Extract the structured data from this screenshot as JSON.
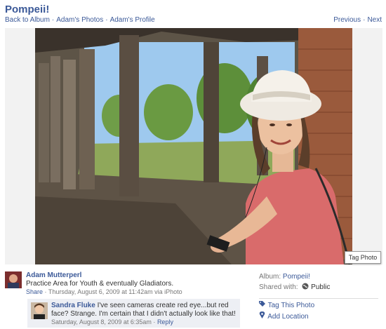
{
  "page": {
    "title": "Pompeii!"
  },
  "nav": {
    "back_to_album": "Back to Album",
    "sep1": "·",
    "adams_photos": "Adam's Photos",
    "sep2": "·",
    "adams_profile": "Adam's Profile",
    "previous": "Previous",
    "sep3": "·",
    "next": "Next"
  },
  "photo": {
    "tag_button": "Tag Photo"
  },
  "post": {
    "author": "Adam Mutterperl",
    "caption": "Practice Area for Youth & eventually Gladiators.",
    "share": "Share",
    "meta": " · Thursday, August 6, 2009 at 11:42am via iPhoto"
  },
  "comment": {
    "author": "Sandra Fluke",
    "text": " I've seen cameras create red eye...but red face? Strange. I'm certain that I didn't actually look like that!",
    "date": "Saturday, August 8, 2009 at 6:35am · ",
    "reply": "Reply"
  },
  "sidebar": {
    "album_label": "Album:",
    "album_value": "Pompeii!",
    "shared_label": "Shared with:",
    "shared_value": "Public",
    "tag_this_photo": "Tag This Photo",
    "add_location": "Add Location"
  },
  "colors": {
    "link": "#3b5998",
    "comment_bg": "#edeff4"
  }
}
